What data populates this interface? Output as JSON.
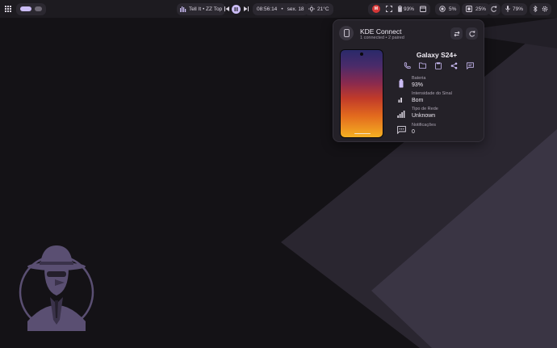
{
  "topbar": {
    "media_title": "Tell It • ZZ Top",
    "clock": "08:56:14",
    "date_sep": "•",
    "date": "sex. 18",
    "weather": "21°C",
    "battery": "93%",
    "brightness": "5%",
    "ram": "25%",
    "tray_level": "79%"
  },
  "kde": {
    "title": "KDE Connect",
    "subtitle": "1 connected • 2 paired",
    "device_name": "Galaxy S24+",
    "stats": [
      {
        "label": "Bateria",
        "value": "93%"
      },
      {
        "label": "Intensidade do Sinal",
        "value": "Bom"
      },
      {
        "label": "Tipo de Rede",
        "value": "Unknown"
      },
      {
        "label": "Notificações",
        "value": "0"
      }
    ]
  },
  "icons": {
    "apps": "apps-grid-icon",
    "music": "equalizer-icon",
    "prev": "previous-icon",
    "play": "pause-icon",
    "next": "next-icon",
    "weather": "sun-icon",
    "notify": "red-badge-icon",
    "screen": "screenshot-icon",
    "battery": "battery-icon",
    "calendar": "calendar-icon",
    "brightness": "brightness-icon",
    "memory": "memory-icon",
    "refresh": "refresh-icon",
    "mic": "microphone-icon",
    "bluetooth": "bluetooth-icon",
    "settings": "settings-icon"
  },
  "colors": {
    "accent": "#cbbcf5",
    "bar_bg": "#1d1b20",
    "panel_bg": "#242128",
    "desktop_bg": "#141216",
    "shape_light": "#3f3a4a",
    "shape_dark": "#2a2630"
  }
}
